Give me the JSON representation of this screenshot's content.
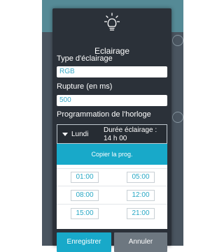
{
  "dialog": {
    "title": "Eclairage",
    "type_label": "Type d'éclairage",
    "type_value": "RGB",
    "rupture_label": "Rupture (en ms)",
    "rupture_value": "500",
    "schedule_label": "Programmation de l'horloge",
    "schedule": {
      "day": "Lundi",
      "duration_line1": "Durée éclairage :",
      "duration_line2": "14 h 00",
      "copy_label": "Copier la prog.",
      "times": [
        {
          "start": "01:00",
          "end": "05:00"
        },
        {
          "start": "08:00",
          "end": "12:00"
        },
        {
          "start": "15:00",
          "end": "21:00"
        }
      ]
    },
    "save_label": "Enregistrer",
    "cancel_label": "Annuler",
    "icon": "lightbulb-icon"
  },
  "colors": {
    "accent": "#18a9c9",
    "dialog_bg": "#2b3139",
    "cancel": "#6d7780"
  }
}
